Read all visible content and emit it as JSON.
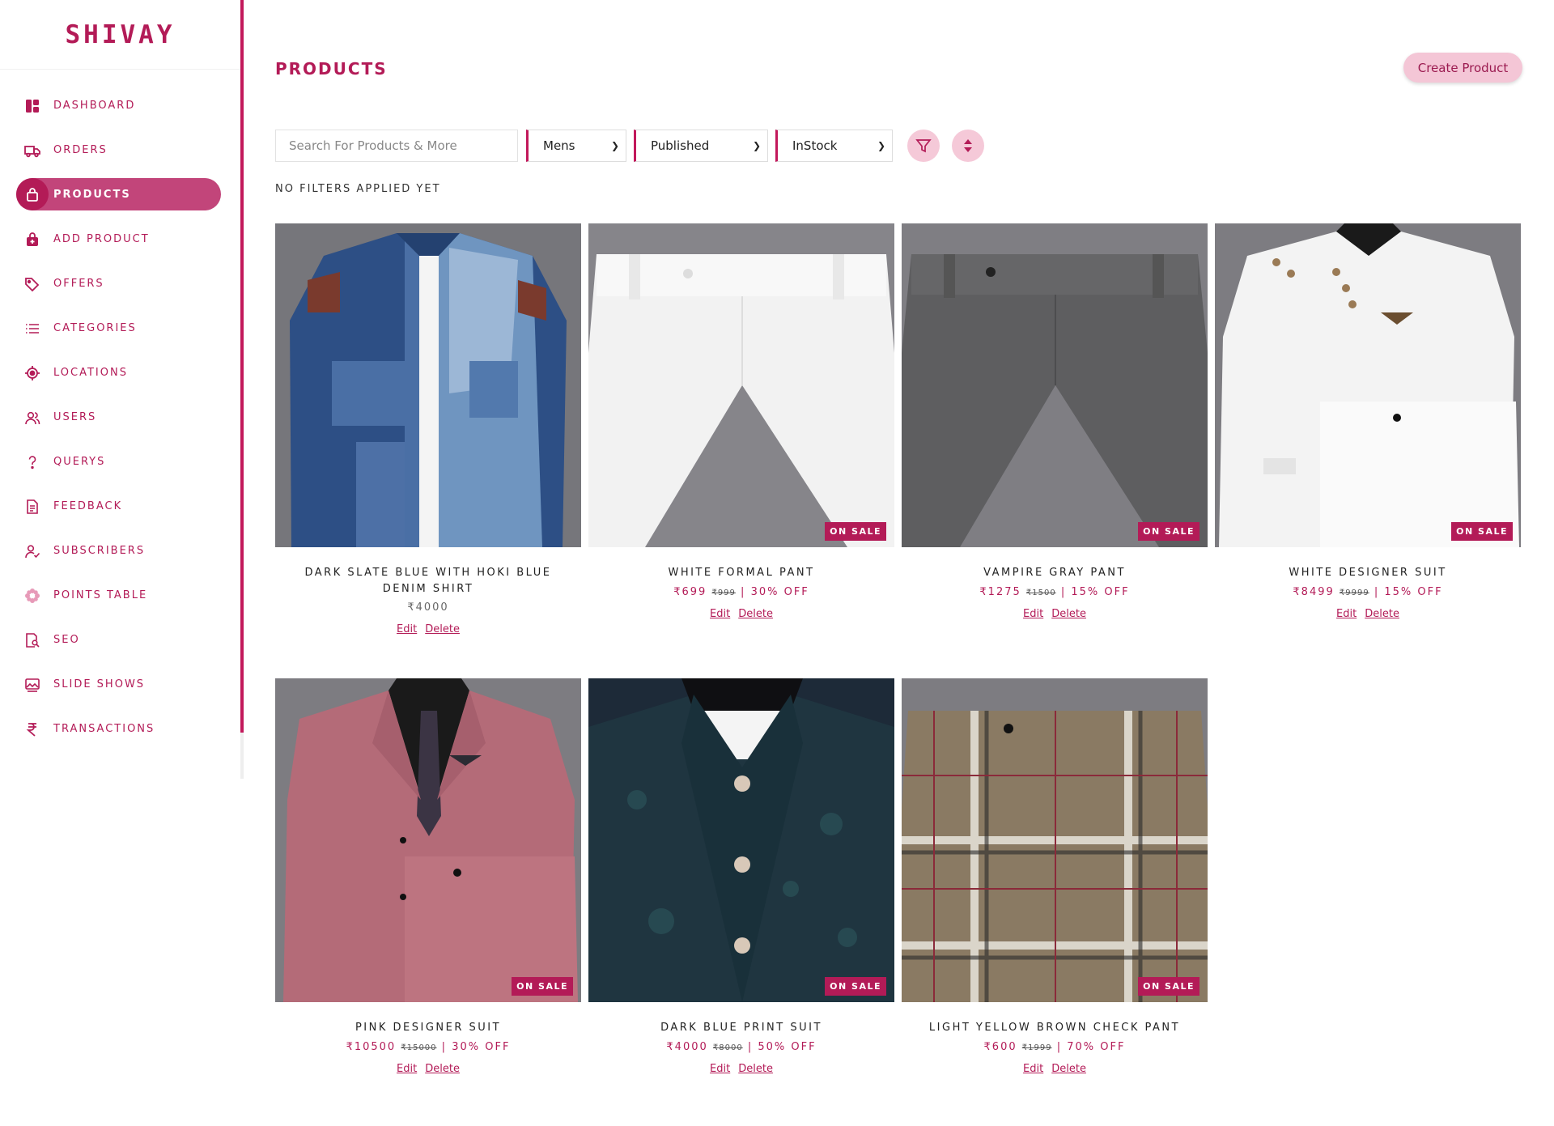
{
  "brand": {
    "logo_text": "SHIVAY",
    "color": "#b31b57"
  },
  "sidebar": {
    "items": [
      {
        "label": "DASHBOARD",
        "icon": "dashboard-icon"
      },
      {
        "label": "ORDERS",
        "icon": "truck-icon"
      },
      {
        "label": "PRODUCTS",
        "icon": "bag-icon",
        "active": true
      },
      {
        "label": "ADD PRODUCT",
        "icon": "add-bag-icon"
      },
      {
        "label": "OFFERS",
        "icon": "tag-icon"
      },
      {
        "label": "CATEGORIES",
        "icon": "list-icon"
      },
      {
        "label": "LOCATIONS",
        "icon": "target-icon"
      },
      {
        "label": "USERS",
        "icon": "users-icon"
      },
      {
        "label": "QUERYS",
        "icon": "question-icon"
      },
      {
        "label": "FEEDBACK",
        "icon": "document-icon"
      },
      {
        "label": "SUBSCRIBERS",
        "icon": "user-check-icon"
      },
      {
        "label": "POINTS TABLE",
        "icon": "flower-icon"
      },
      {
        "label": "SEO",
        "icon": "search-doc-icon"
      },
      {
        "label": "SLIDE SHOWS",
        "icon": "image-icon"
      },
      {
        "label": "TRANSACTIONS",
        "icon": "rupee-icon"
      }
    ]
  },
  "header": {
    "title": "PRODUCTS",
    "create_label": "Create Product"
  },
  "toolbar": {
    "search_placeholder": "Search For Products & More",
    "gender": "Mens",
    "status": "Published",
    "stock": "InStock",
    "filter_icon": "filter-icon",
    "sort_icon": "sort-icon"
  },
  "filters_note": "NO FILTERS APPLIED YET",
  "products": [
    {
      "name": "DARK SLATE BLUE WITH HOKI BLUE DENIM SHIRT",
      "price": "₹4000",
      "on_sale": false,
      "edit": "Edit",
      "delete": "Delete"
    },
    {
      "name": "WHITE FORMAL PANT",
      "price": "₹699",
      "old_price": "₹999",
      "discount": "30% OFF",
      "on_sale": true,
      "badge": "ON SALE",
      "edit": "Edit",
      "delete": "Delete"
    },
    {
      "name": "VAMPIRE GRAY PANT",
      "price": "₹1275",
      "old_price": "₹1500",
      "discount": "15% OFF",
      "on_sale": true,
      "badge": "ON SALE",
      "edit": "Edit",
      "delete": "Delete"
    },
    {
      "name": "WHITE DESIGNER SUIT",
      "price": "₹8499",
      "old_price": "₹9999",
      "discount": "15% OFF",
      "on_sale": true,
      "badge": "ON SALE",
      "edit": "Edit",
      "delete": "Delete"
    },
    {
      "name": "PINK DESIGNER SUIT",
      "price": "₹10500",
      "old_price": "₹15000",
      "discount": "30% OFF",
      "on_sale": true,
      "badge": "ON SALE",
      "edit": "Edit",
      "delete": "Delete"
    },
    {
      "name": "DARK BLUE PRINT SUIT",
      "price": "₹4000",
      "old_price": "₹8000",
      "discount": "50% OFF",
      "on_sale": true,
      "badge": "ON SALE",
      "edit": "Edit",
      "delete": "Delete"
    },
    {
      "name": "LIGHT YELLOW BROWN CHECK PANT",
      "price": "₹600",
      "old_price": "₹1999",
      "discount": "70% OFF",
      "on_sale": true,
      "badge": "ON SALE",
      "edit": "Edit",
      "delete": "Delete"
    }
  ]
}
